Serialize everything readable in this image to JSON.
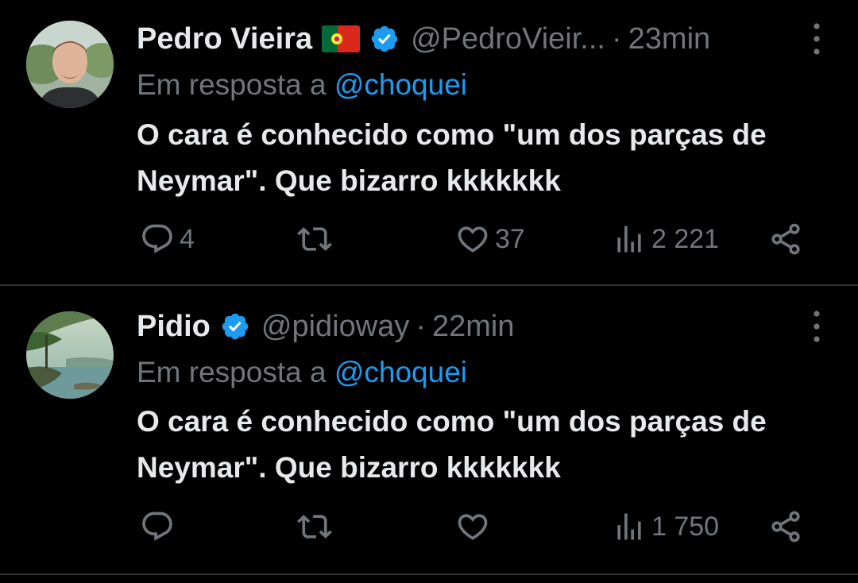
{
  "tweets": [
    {
      "name": "Pedro Vieira",
      "handle": "@PedroVieir...",
      "time": "23min",
      "reply_prefix": "Em resposta a ",
      "reply_mention": "@choquei",
      "text_line1": "O cara é conhecido como \"um dos parças de",
      "text_line2": "Neymar\". Que bizarro kkkkkkk",
      "replies": "4",
      "retweets": "",
      "likes": "37",
      "views": "2 221",
      "has_flag": true,
      "verified": true
    },
    {
      "name": "Pidio",
      "handle": "@pidioway",
      "time": "22min",
      "reply_prefix": "Em resposta a ",
      "reply_mention": "@choquei",
      "text_line1": "O cara é conhecido como \"um dos parças de",
      "text_line2": "Neymar\". Que bizarro kkkkkkk",
      "replies": "",
      "retweets": "",
      "likes": "",
      "views": "1 750",
      "has_flag": false,
      "verified": true
    }
  ],
  "separator": "·",
  "icons": {
    "reply": "reply-icon",
    "retweet": "retweet-icon",
    "like": "heart-icon",
    "views": "views-icon",
    "share": "share-icon",
    "more": "more-icon",
    "verified": "verified-badge-icon",
    "flag": "portugal-flag-icon"
  },
  "colors": {
    "background": "#000000",
    "text": "#e7e9ea",
    "muted": "#71767b",
    "accent": "#1d9bf0",
    "divider": "#2f3336"
  }
}
